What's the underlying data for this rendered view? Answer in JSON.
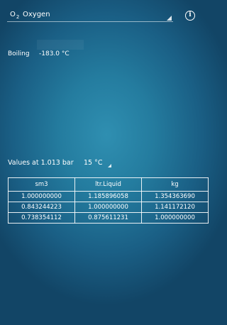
{
  "gas": {
    "symbol": "O",
    "symbol_subscript": "2",
    "name": "Oxygen"
  },
  "info_icon": {
    "icon": "info-icon",
    "glyph": "i"
  },
  "boiling": {
    "label": "Boiling",
    "value": "-183.0 °C"
  },
  "conditions": {
    "label": "Values at 1.013 bar",
    "temperature": "15 °C"
  },
  "table": {
    "headers": [
      "sm3",
      "ltr.Liquid",
      "kg"
    ],
    "rows": [
      [
        "1.000000000",
        "1.185896058",
        "1.354363690"
      ],
      [
        "0.843244223",
        "1.000000000",
        "1.141172120"
      ],
      [
        "0.738354112",
        "0.875611231",
        "1.000000000"
      ]
    ]
  },
  "colors": {
    "background_center": "#2f8fb1",
    "background_edge": "#124566",
    "text": "#ffffff"
  }
}
